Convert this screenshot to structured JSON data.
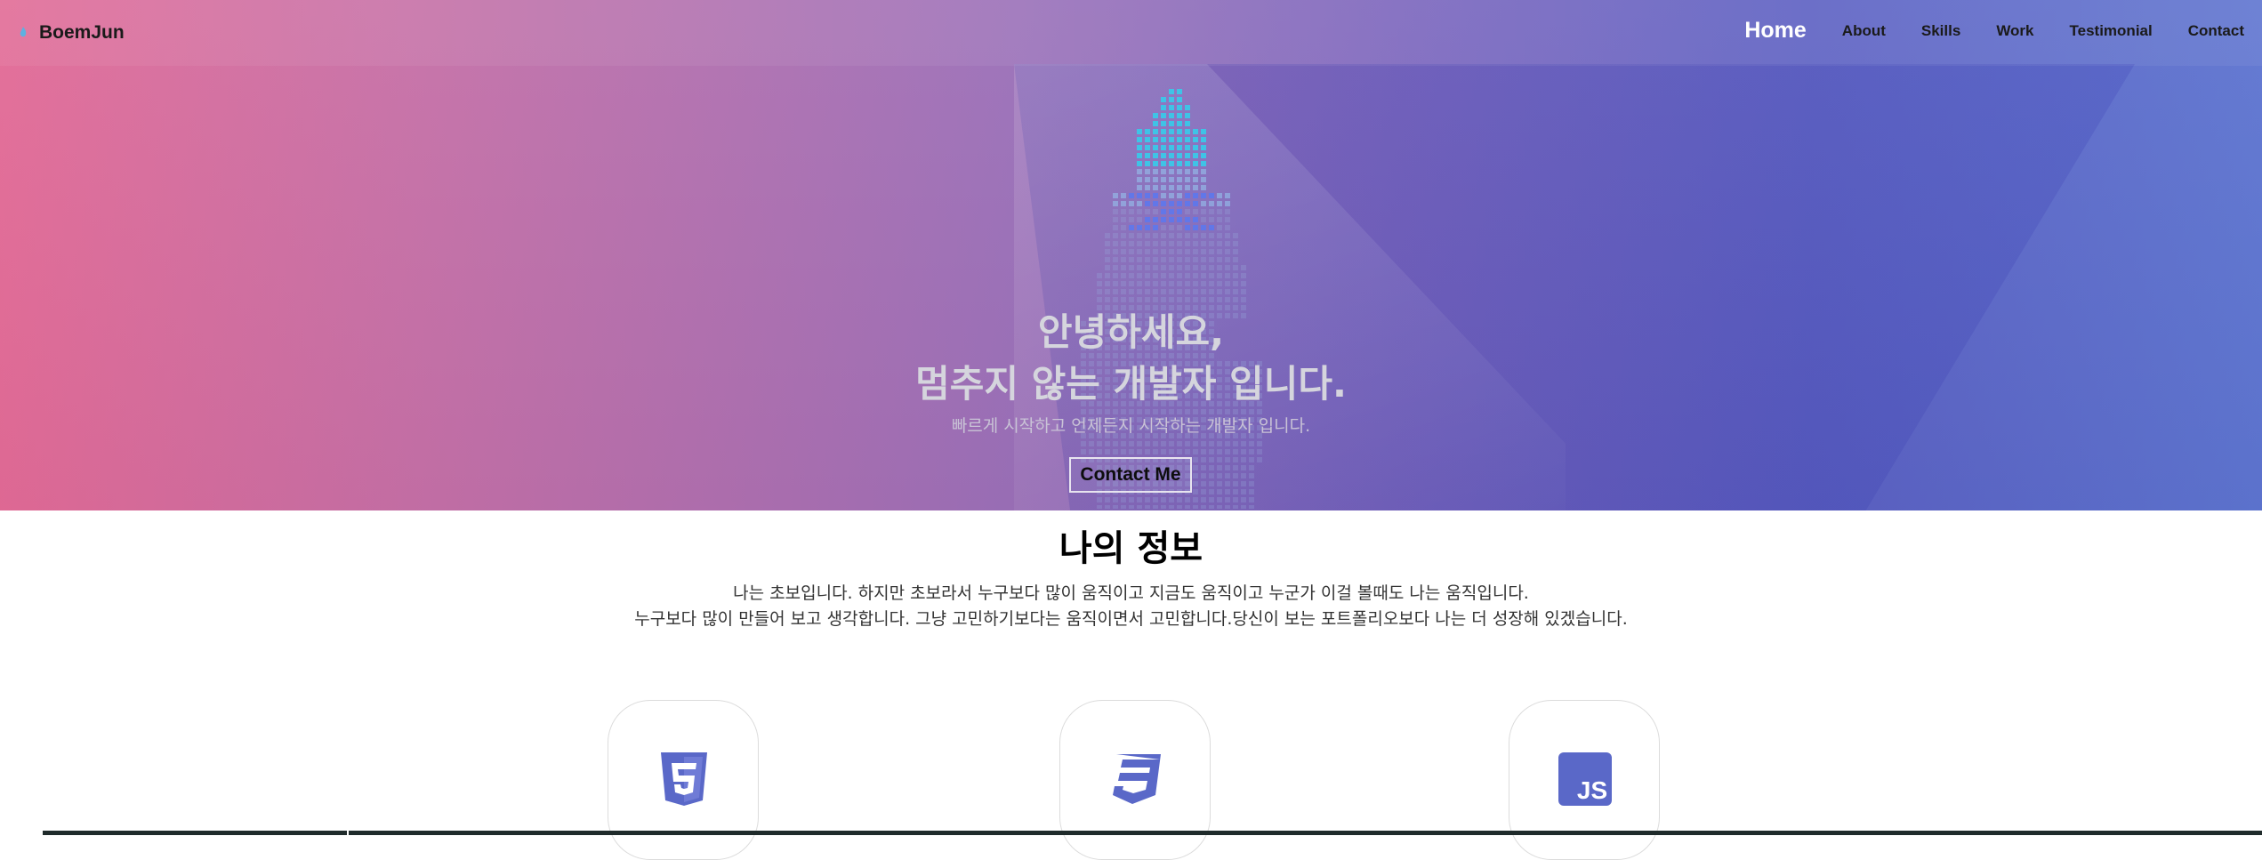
{
  "header": {
    "logo_text": "BoemJun",
    "logo_icon": "flame-icon",
    "nav": [
      "Home",
      "About",
      "Skills",
      "Work",
      "Testimonial",
      "Contact"
    ],
    "active": "Home"
  },
  "hero": {
    "title_line1": "안녕하세요,",
    "title_line2": "멈추지 않는 개발자 입니다.",
    "subtitle": "빠르게 시작하고 언제든지 시작하는 개발자 입니다.",
    "cta_label": "Contact Me",
    "illustration": "pixel-skull-flame-icon",
    "colors": {
      "gradient_start": "#e26a96",
      "gradient_end": "#5d74d0",
      "pixel_accent": "#3fc3e6"
    }
  },
  "about": {
    "title": "나의 정보",
    "desc_line1": "나는 초보입니다. 하지만 초보라서 누구보다 많이 움직이고 지금도 움직이고 누군가 이걸 볼때도 나는 움직입니다.",
    "desc_line2": "누구보다 많이 만들어 보고 생각합니다. 그냥 고민하기보다는 움직이면서 고민합니다.당신이 보는 포트폴리오보다 나는 더 성장해 있겠습니다."
  },
  "skills": [
    {
      "icon": "html5-icon",
      "color": "#5a68c8"
    },
    {
      "icon": "css3-icon",
      "color": "#5a68c8"
    },
    {
      "icon": "js-icon",
      "color": "#5a68c8",
      "label": "JS"
    }
  ]
}
